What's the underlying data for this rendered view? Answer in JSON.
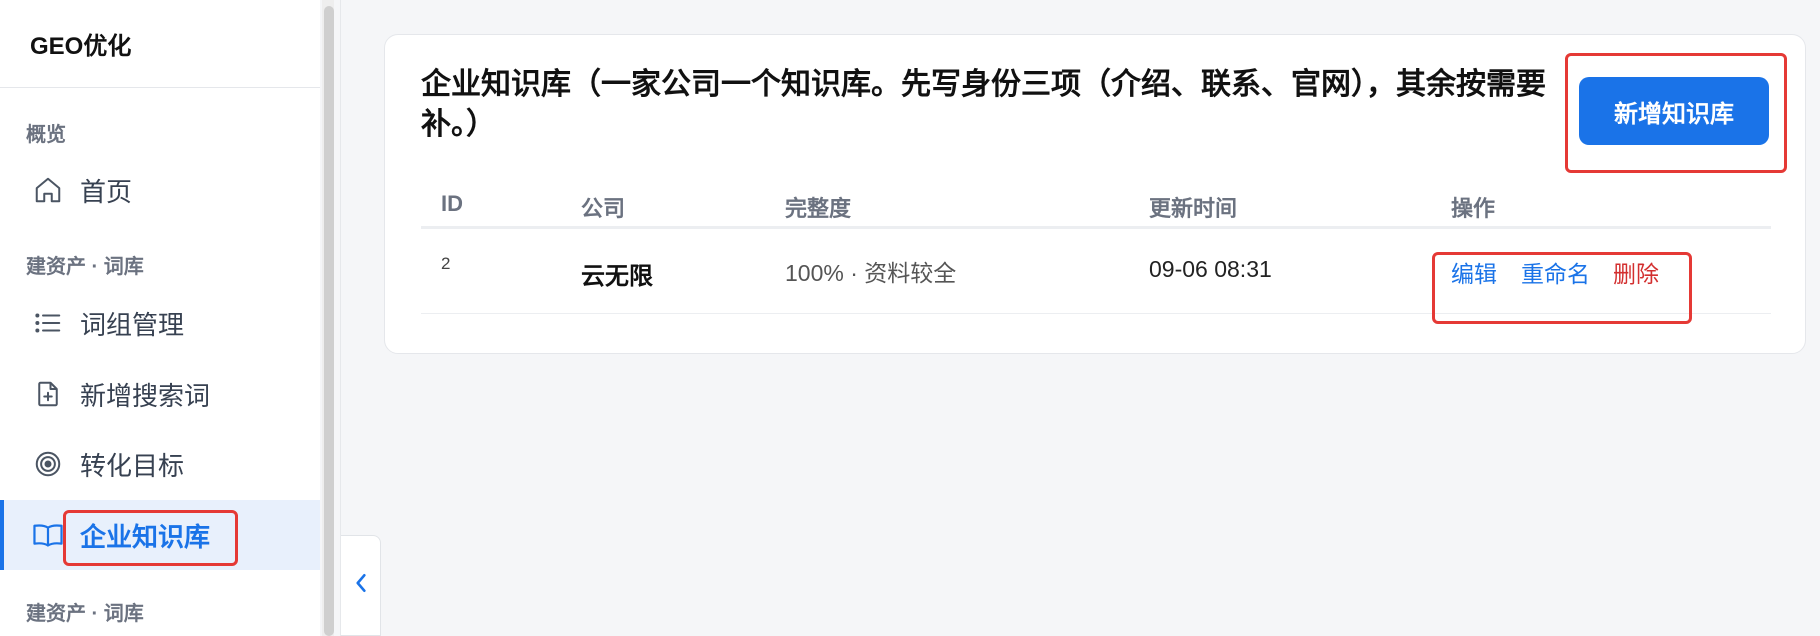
{
  "brand": "GEO优化",
  "sidebar": {
    "sections": [
      "概览",
      "建资产 · 词库",
      "建资产 · 词库"
    ],
    "items": [
      {
        "label": "首页",
        "icon": "home-icon"
      },
      {
        "label": "词组管理",
        "icon": "list-icon"
      },
      {
        "label": "新增搜索词",
        "icon": "file-add-icon"
      },
      {
        "label": "转化目标",
        "icon": "target-icon"
      },
      {
        "label": "企业知识库",
        "icon": "book-icon",
        "active": true
      }
    ]
  },
  "main": {
    "title": "企业知识库（一家公司一个知识库。先写身份三项（介绍、联系、官网），其余按需要补。）",
    "add_button": "新增知识库",
    "table": {
      "headers": [
        "ID",
        "公司",
        "完整度",
        "更新时间",
        "操作"
      ],
      "rows": [
        {
          "id": "2",
          "company": "云无限",
          "completeness": "100% · 资料较全",
          "updated": "09-06 08:31",
          "actions": [
            "编辑",
            "重命名",
            "删除"
          ]
        }
      ]
    }
  },
  "colors": {
    "accent": "#1a73e8",
    "danger": "#d32f2f",
    "highlight": "#e53935"
  }
}
